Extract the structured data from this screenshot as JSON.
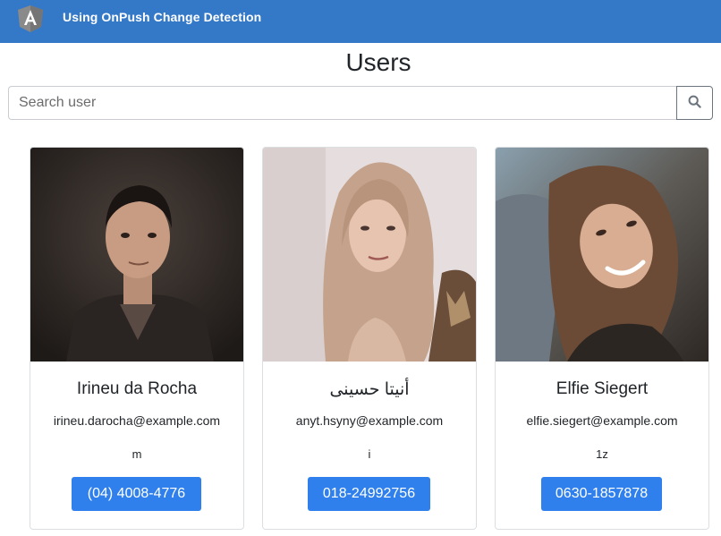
{
  "header": {
    "app_title": "Using OnPush Change Detection",
    "logo_icon": "angular-logo-icon",
    "background_color": "#3478c8"
  },
  "main": {
    "page_title": "Users",
    "search": {
      "placeholder": "Search user",
      "value": "",
      "button_icon": "search-icon"
    },
    "users": [
      {
        "name": "Irineu da Rocha",
        "email": "irineu.darocha@example.com",
        "tag": "m",
        "phone": "(04) 4008-4776",
        "photo": "user-photo-portrait"
      },
      {
        "name": "أنيتا حسینی",
        "email": "anyt.hsyny@example.com",
        "tag": "i",
        "phone": "018-24992756",
        "photo": "user-photo-portrait"
      },
      {
        "name": "Elfie Siegert",
        "email": "elfie.siegert@example.com",
        "tag": "1z",
        "phone": "0630-1857878",
        "photo": "user-photo-portrait"
      }
    ],
    "button_color": "#2f80ed"
  }
}
